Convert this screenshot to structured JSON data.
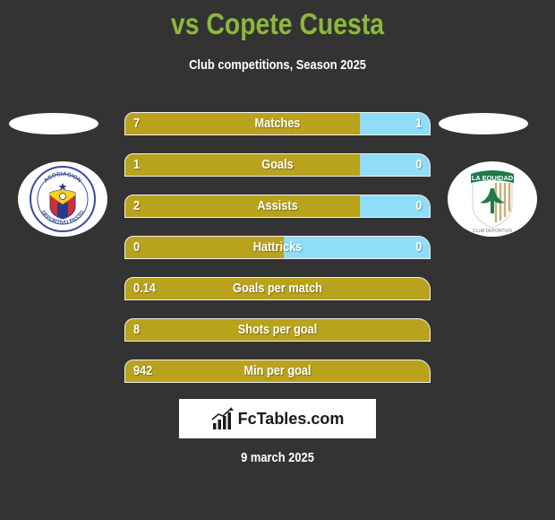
{
  "header": {
    "title": "vs Copete Cuesta",
    "subtitle": "Club competitions, Season 2025"
  },
  "teams": {
    "left": {
      "name": "Asociación Deportivo Pasto",
      "badge_top_text": "ASOCIACION",
      "badge_bottom_text": "DEPORTIVO PASTO"
    },
    "right": {
      "name": "La Equidad Club Deportivo",
      "badge_top_text": "LA EQUIDAD",
      "badge_bottom_text": "CLUB DEPORTIVO"
    }
  },
  "colors": {
    "title": "#8DB83B",
    "left_bar": "#B9A21C",
    "right_bar": "#8FDDF8",
    "background": "#333333"
  },
  "stats": [
    {
      "label": "Matches",
      "left": "7",
      "right": "1",
      "left_fill_fraction": 0.77
    },
    {
      "label": "Goals",
      "left": "1",
      "right": "0",
      "left_fill_fraction": 0.77
    },
    {
      "label": "Assists",
      "left": "2",
      "right": "0",
      "left_fill_fraction": 0.77
    },
    {
      "label": "Hattricks",
      "left": "0",
      "right": "0",
      "left_fill_fraction": 0.52
    },
    {
      "label": "Goals per match",
      "left": "0.14",
      "right": null,
      "left_fill_fraction": 1.0
    },
    {
      "label": "Shots per goal",
      "left": "8",
      "right": null,
      "left_fill_fraction": 1.0
    },
    {
      "label": "Min per goal",
      "left": "942",
      "right": null,
      "left_fill_fraction": 1.0
    }
  ],
  "brand": {
    "text": "FcTables.com",
    "icon": "bar-chart-trend-icon"
  },
  "footer": {
    "date": "9 march 2025"
  }
}
